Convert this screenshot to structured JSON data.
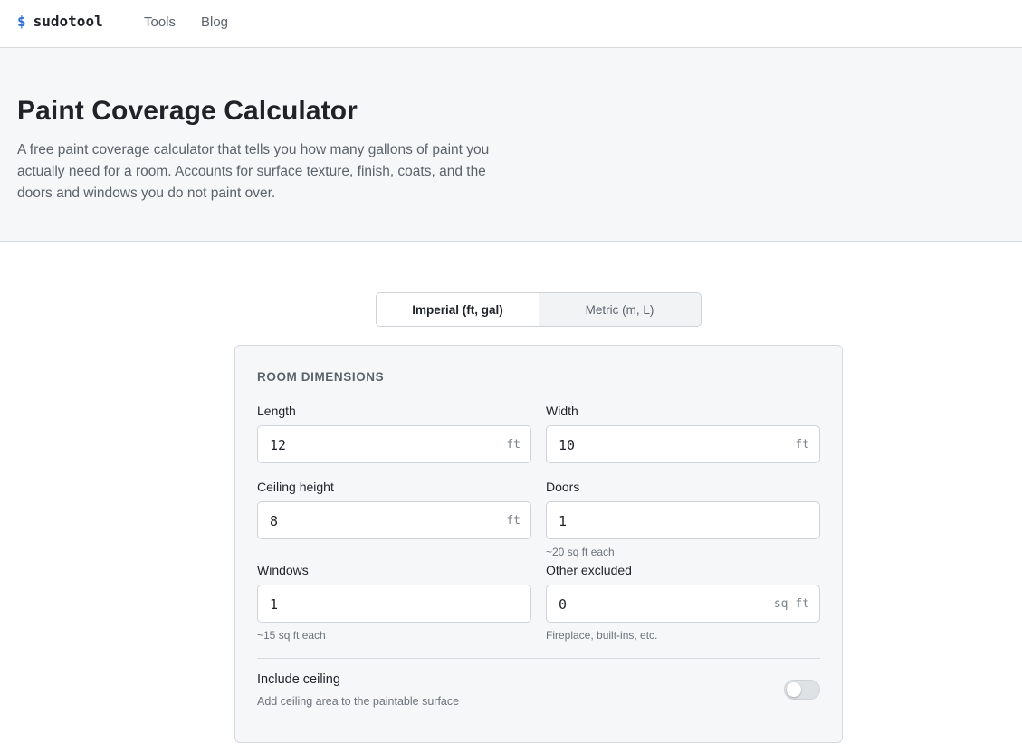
{
  "nav": {
    "logo_symbol": "$",
    "logo_text": "sudotool",
    "links": [
      "Tools",
      "Blog"
    ]
  },
  "hero": {
    "title": "Paint Coverage Calculator",
    "description": "A free paint coverage calculator that tells you how many gallons of paint you actually need for a room. Accounts for surface texture, finish, coats, and the doors and windows you do not paint over."
  },
  "units": {
    "options": [
      "Imperial (ft, gal)",
      "Metric (m, L)"
    ],
    "selected": "Imperial (ft, gal)"
  },
  "room": {
    "section_title": "ROOM DIMENSIONS",
    "length": {
      "label": "Length",
      "value": "12",
      "unit": "ft"
    },
    "width": {
      "label": "Width",
      "value": "10",
      "unit": "ft"
    },
    "ceiling_height": {
      "label": "Ceiling height",
      "value": "8",
      "unit": "ft"
    },
    "doors": {
      "label": "Doors",
      "value": "1",
      "hint": "~20 sq ft each"
    },
    "windows": {
      "label": "Windows",
      "value": "1",
      "hint": "~15 sq ft each"
    },
    "other_excluded": {
      "label": "Other excluded",
      "value": "0",
      "unit": "sq ft",
      "hint": "Fireplace, built-ins, etc."
    }
  },
  "include_ceiling": {
    "label": "Include ceiling",
    "description": "Add ceiling area to the paintable surface",
    "enabled": false
  },
  "colors": {
    "accent": "#2f6fd6",
    "hero_bg": "#f5f7f9",
    "card_bg": "#f5f7f9"
  }
}
